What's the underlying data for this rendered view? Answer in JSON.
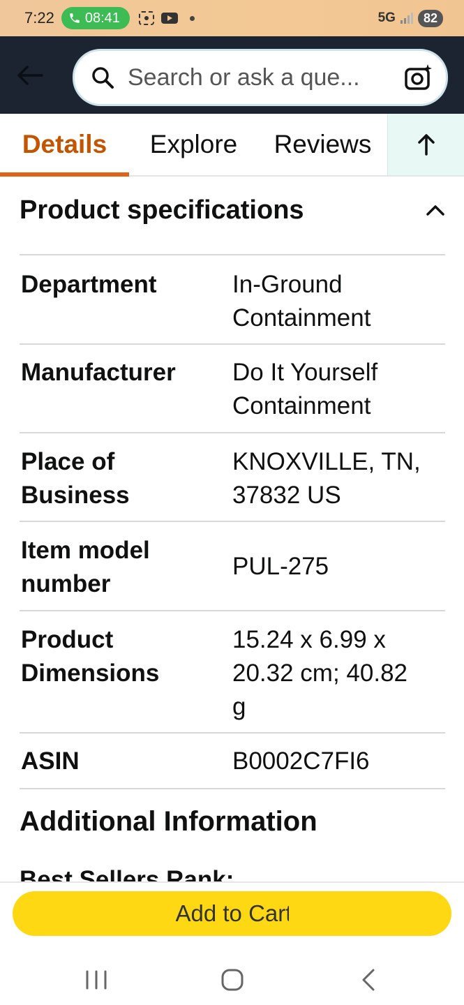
{
  "status_bar": {
    "time": "7:22",
    "call_timer": "08:41",
    "network": "5G",
    "battery": "82"
  },
  "search": {
    "placeholder": "Search or ask a que..."
  },
  "tabs": [
    {
      "label": "Details",
      "active": true
    },
    {
      "label": "Explore",
      "active": false
    },
    {
      "label": "Reviews",
      "active": false
    }
  ],
  "section": {
    "title": "Product specifications"
  },
  "specs": [
    {
      "label": "Department",
      "value": "In-Ground Containment"
    },
    {
      "label": "Manufacturer",
      "value": "Do It Yourself Containment"
    },
    {
      "label": "Place of Business",
      "value": "KNOXVILLE, TN, 37832 US"
    },
    {
      "label": "Item model number",
      "value": "PUL-275"
    },
    {
      "label": "Product Dimensions",
      "value": "15.24 x 6.99 x 20.32 cm; 40.82 g"
    },
    {
      "label": "ASIN",
      "value": "B0002C7FI6"
    }
  ],
  "additional": {
    "title": "Additional Information",
    "best_sellers": "Best Sellers Rank:"
  },
  "cart": {
    "label": "Add to Cart"
  },
  "colors": {
    "header_bg": "#1b2430",
    "accent_orange": "#c45500",
    "cart_yellow": "#ffd814",
    "call_green": "#3dbb55"
  }
}
